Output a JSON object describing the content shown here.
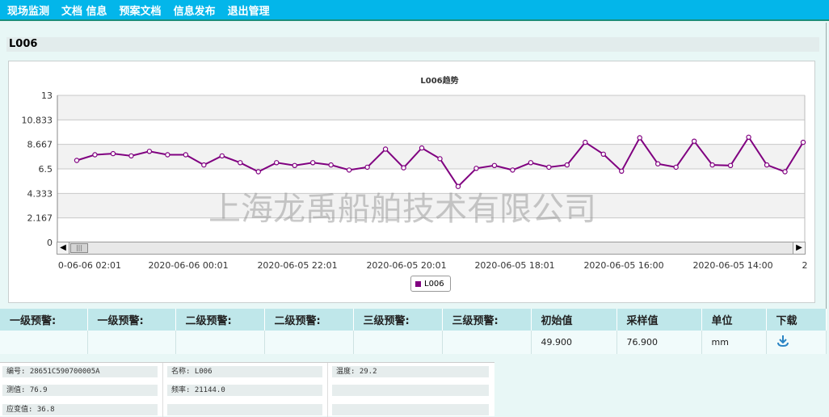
{
  "nav": {
    "items": [
      "现场监测",
      "文档 信息",
      "预案文档",
      "信息发布",
      "退出管理"
    ]
  },
  "page_title": "L006",
  "chart_data": {
    "type": "line",
    "title": "L006趋势",
    "series": [
      {
        "name": "L006",
        "color": "#800080",
        "values": [
          7.25,
          7.75,
          7.85,
          7.65,
          8.05,
          7.75,
          7.75,
          6.85,
          7.65,
          7.05,
          6.25,
          7.05,
          6.8,
          7.05,
          6.85,
          6.4,
          6.65,
          8.25,
          6.6,
          8.35,
          7.4,
          4.95,
          6.55,
          6.8,
          6.4,
          7.05,
          6.65,
          6.85,
          8.85,
          7.8,
          6.3,
          9.25,
          6.95,
          6.65,
          8.95,
          6.85,
          6.8,
          9.3,
          6.85,
          6.25,
          8.85
        ]
      }
    ],
    "ylim": [
      0,
      13
    ],
    "yticks": [
      "0",
      "2.167",
      "4.333",
      "6.5",
      "8.667",
      "10.833",
      "13"
    ],
    "xticks": [
      "0-06-06 02:01",
      "2020-06-06 00:01",
      "2020-06-05 22:01",
      "2020-06-05 20:01",
      "2020-06-05 18:01",
      "2020-06-05 16:00",
      "2020-06-05 14:00",
      "2"
    ],
    "grid": true,
    "legend": "bottom-center"
  },
  "watermark": "上海龙禹船舶技术有限公司",
  "scrollbar": {
    "left_arrow": "◀",
    "right_arrow": "▶",
    "thumb_grip": "|||"
  },
  "alarm_table": {
    "headers": [
      "一级预警:",
      "一级预警:",
      "二级预警:",
      "二级预警:",
      "三级预警:",
      "三级预警:",
      "初始值",
      "采样值",
      "单位",
      "下载"
    ],
    "row": [
      "",
      "",
      "",
      "",
      "",
      "",
      "49.900",
      "76.900",
      "mm",
      ""
    ]
  },
  "info": {
    "serial": "编号: 28651C590700005A",
    "name": "名称: L006",
    "temperature": "温度: 29.2",
    "measured": "测值: 76.9",
    "frequency": "频率: 21144.0",
    "strain": "应变值: 36.8"
  },
  "icons": {
    "download": "download-icon"
  }
}
